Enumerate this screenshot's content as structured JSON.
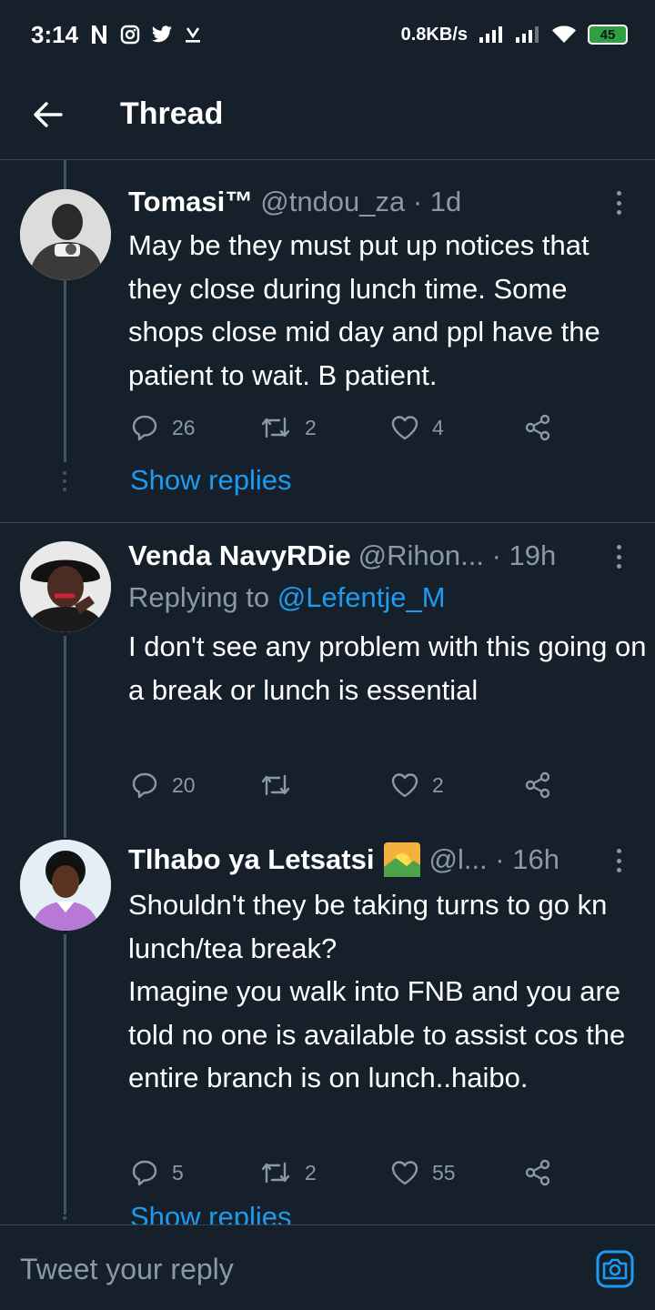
{
  "statusbar": {
    "time": "3:14",
    "speed": "0.8KB/s",
    "battery": "45",
    "icons": [
      "netflix-icon",
      "instagram-icon",
      "twitter-icon",
      "download-icon",
      "signal-icon",
      "signal-icon",
      "wifi-icon",
      "battery-icon"
    ]
  },
  "header": {
    "title": "Thread",
    "back_icon": "arrow-left-icon"
  },
  "tweets": [
    {
      "name": "Tomasi™",
      "handle": "@tndou_za · 1d",
      "text": "May be they must put up notices that they close during lunch time. Some shops close mid day and ppl have the patient to wait. B patient.",
      "replies": "26",
      "retweets": "2",
      "likes": "4",
      "show_replies": "Show replies"
    },
    {
      "name": "Venda NavyRDie",
      "handle": "@Rihon... · 19h",
      "replying_label": "Replying to",
      "replying_to": "@Lefentje_M",
      "text": "I don't see any problem with this going on a break or lunch is essential",
      "replies": "20",
      "retweets": "",
      "likes": "2"
    },
    {
      "name": "Tlhabo ya Letsatsi",
      "handle": "@l... · 16h",
      "text": "Shouldn't they be taking turns to go kn lunch/tea break?\nImagine you walk into FNB and you are told no one is available to assist cos the entire branch is on lunch..haibo.",
      "replies": "5",
      "retweets": "2",
      "likes": "55",
      "show_replies": "Show replies"
    }
  ],
  "reply_bar": {
    "placeholder": "Tweet your reply",
    "camera_icon": "camera-icon"
  },
  "colors": {
    "background": "#15202b",
    "accent": "#1d9bf0",
    "secondary_text": "#8b98a5",
    "divider": "#38444d"
  }
}
